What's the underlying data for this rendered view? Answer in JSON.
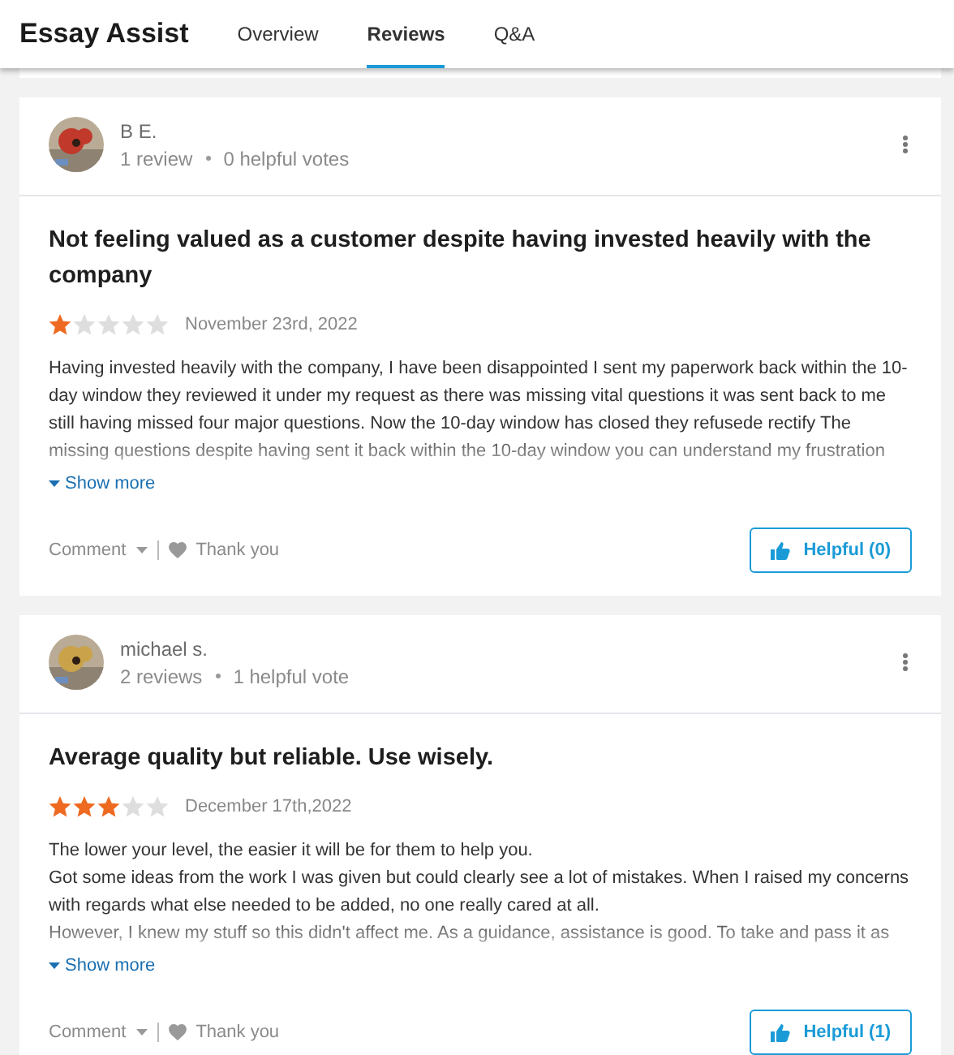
{
  "header": {
    "brand": "Essay Assist",
    "tabs": [
      {
        "label": "Overview",
        "selected": false
      },
      {
        "label": "Reviews",
        "selected": true
      },
      {
        "label": "Q&A",
        "selected": false
      }
    ]
  },
  "reviews": [
    {
      "author": "B E.",
      "review_count": "1 review",
      "helpful_votes": "0 helpful votes",
      "title": "Not feeling valued as a customer despite having invested heavily with the company",
      "stars": 1,
      "date": "November 23rd, 2022",
      "body": [
        "Having invested heavily with the company, I have been disappointed I sent my paperwork back within the 10-day window they reviewed it under my request as there was missing vital questions it was sent back to me still having missed four major questions. Now the 10-day window has closed they refusede rectify The missing questions despite having sent it back within the 10-day window you can understand my frustration"
      ],
      "show_more": "Show more",
      "comment": "Comment",
      "thank_you": "Thank you",
      "helpful": "Helpful (0)"
    },
    {
      "author": "michael s.",
      "review_count": "2 reviews",
      "helpful_votes": "1 helpful vote",
      "title": "Average quality but reliable. Use wisely.",
      "stars": 3,
      "date": "December 17th,2022",
      "body": [
        "The lower your level, the easier it will be for them to help you.",
        "Got some ideas from the work I was given but could clearly see a lot of mistakes. When I raised my concerns with regards what else needed to be added, no one really cared at all.",
        "However, I knew my stuff so this didn't affect me. As a guidance, assistance is good. To take and pass it as"
      ],
      "show_more": "Show more",
      "comment": "Comment",
      "thank_you": "Thank you",
      "helpful": "Helpful (1)"
    }
  ]
}
